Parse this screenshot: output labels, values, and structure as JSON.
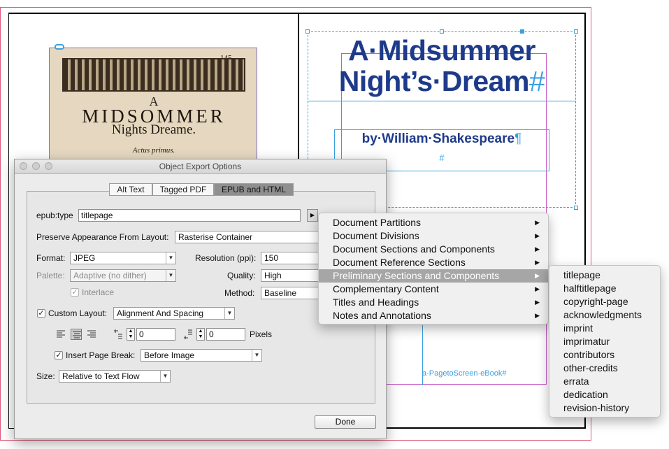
{
  "document": {
    "book_title_line1": "A·Midsummer",
    "book_title_line2": "Night’s·Dream",
    "title_end_mark": "#",
    "byline": "by·William·Shakespeare",
    "byline_end_mark": "¶",
    "byline_hash": "#",
    "footer_text": "a·PagetoScreen·eBook#",
    "scan_page_number": "145",
    "scan_a": "A",
    "scan_title": "MIDSOMMER",
    "scan_subtitle": "Nights Dreame.",
    "scan_act": "Actus primus."
  },
  "dialog": {
    "title": "Object Export Options",
    "tabs": [
      "Alt Text",
      "Tagged PDF",
      "EPUB and HTML"
    ],
    "active_tab": "EPUB and HTML",
    "epub_type_label": "epub:type",
    "epub_type_value": "titlepage",
    "preserve_label": "Preserve Appearance From Layout:",
    "preserve_value": "Rasterise Container",
    "format_label": "Format:",
    "format_value": "JPEG",
    "palette_label": "Palette:",
    "palette_value": "Adaptive (no dither)",
    "interlace_label": "Interlace",
    "resolution_label": "Resolution (ppi):",
    "resolution_value": "150",
    "quality_label": "Quality:",
    "quality_value": "High",
    "method_label": "Method:",
    "method_value": "Baseline",
    "custom_layout_label": "Custom Layout:",
    "custom_layout_value": "Alignment And Spacing",
    "space_before_value": "0",
    "space_after_value": "0",
    "pixels_label": "Pixels",
    "insert_break_label": "Insert Page Break:",
    "insert_break_value": "Before Image",
    "size_label": "Size:",
    "size_value": "Relative to Text Flow",
    "done_label": "Done"
  },
  "menu": {
    "items": [
      "Document Partitions",
      "Document Divisions",
      "Document Sections and Components",
      "Document Reference Sections",
      "Preliminary Sections and Components",
      "Complementary Content",
      "Titles and Headings",
      "Notes and Annotations"
    ],
    "highlighted": "Preliminary Sections and Components",
    "submenu_items": [
      "titlepage",
      "halftitlepage",
      "copyright-page",
      "acknowledgments",
      "imprint",
      "imprimatur",
      "contributors",
      "other-credits",
      "errata",
      "dedication",
      "revision-history"
    ]
  },
  "colors": {
    "title_blue": "#1e3a8a",
    "frame_blue": "#3aa0e0",
    "margin_magenta": "#c75ac7",
    "menu_highlight": "#a6a6a6"
  }
}
